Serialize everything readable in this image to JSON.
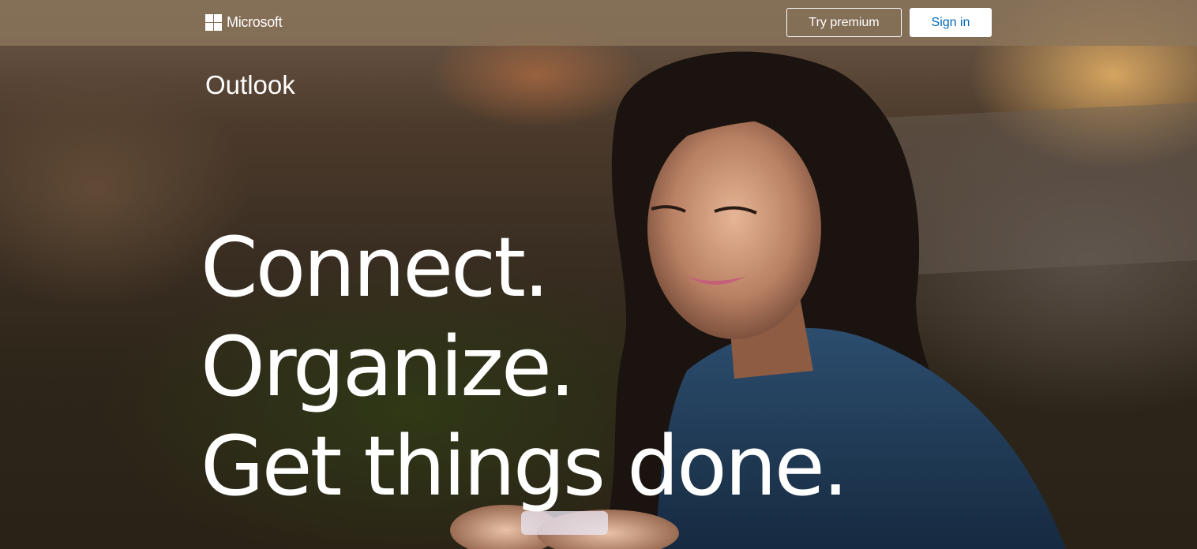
{
  "header": {
    "brand": "Microsoft",
    "try_premium_label": "Try premium",
    "sign_in_label": "Sign in"
  },
  "hero": {
    "product_name": "Outlook",
    "headline_lines": [
      "Connect.",
      "Organize.",
      "Get things done."
    ]
  },
  "icons": {
    "brand_logo": "microsoft-logo-icon"
  },
  "colors": {
    "sign_in_text": "#0067b8",
    "button_background": "#ffffff",
    "text": "#ffffff"
  }
}
